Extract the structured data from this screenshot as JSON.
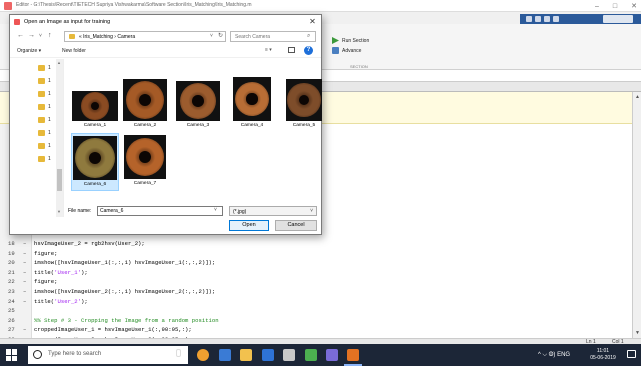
{
  "editor": {
    "title": "Editor - G:\\Thesis\\Recent\\TIETECH Supriya Vishwakarma\\Software Section\\Iris_Matching\\Iris_Matching.m",
    "ribbon": {
      "run_section": "Run Section",
      "advance": "Advance",
      "section_group": "SECTION"
    },
    "code_lines": [
      {
        "n": "18",
        "dash": "–",
        "text": "hsvImageUser_2 = rgb2hsv(User_2);",
        "kind": "code"
      },
      {
        "n": "19",
        "dash": "–",
        "text": "figure;",
        "kind": "code"
      },
      {
        "n": "20",
        "dash": "–",
        "text": "imshow([hsvImageUser_1(:,:,1) hsvImageUser_1(:,:,2)]);",
        "kind": "code"
      },
      {
        "n": "21",
        "dash": "–",
        "text_pre": "title(",
        "str": "'User_1'",
        "text_post": ");",
        "kind": "str"
      },
      {
        "n": "22",
        "dash": "–",
        "text": "figure;",
        "kind": "code"
      },
      {
        "n": "23",
        "dash": "–",
        "text": "imshow([hsvImageUser_2(:,:,1) hsvImageUser_2(:,:,2)]);",
        "kind": "code"
      },
      {
        "n": "24",
        "dash": "–",
        "text_pre": "title(",
        "str": "'User_2'",
        "text_post": ");",
        "kind": "str"
      },
      {
        "n": "25",
        "dash": "",
        "text": "",
        "kind": "code"
      },
      {
        "n": "26",
        "dash": "",
        "text": "%% Step # 3 - Cropping the Image from a random position",
        "kind": "comment"
      },
      {
        "n": "27",
        "dash": "–",
        "text": "croppedImageUser_1 = hsvImageUser_1(:,90:95,:);",
        "kind": "code"
      },
      {
        "n": "28",
        "dash": "–",
        "text": "croppedImageUser_2 = hsvImageUser_2(:,93:95,:);",
        "kind": "code"
      }
    ],
    "status": {
      "ln": "Ln  1",
      "col": "Col  1"
    }
  },
  "dialog": {
    "title": "Open an Image as input for training",
    "close_glyph": "✕",
    "nav": {
      "back": "←",
      "forward": "→",
      "recent": "˅",
      "up": "↑"
    },
    "address": "«  Iris_Matching  ›  Camera",
    "address_dropdown": "˅",
    "address_refresh": "↻",
    "search_placeholder": "Search Camera",
    "search_glyph": "⌕",
    "toolbar": {
      "organize": "Organize ▾",
      "new_folder": "New folder",
      "view": "≡ ▾",
      "help": "?"
    },
    "nav_items": [
      "1",
      "1",
      "1",
      "1",
      "1",
      "1",
      "1",
      "1"
    ],
    "nav_scroll_up": "▲",
    "nav_scroll_down": "▼",
    "files": [
      {
        "label": "Camera_1",
        "iris": "#8a4b22",
        "selected": false
      },
      {
        "label": "Camera_2",
        "iris": "#a55a26",
        "selected": false
      },
      {
        "label": "Camera_3",
        "iris": "#9c5c2e",
        "selected": false
      },
      {
        "label": "Camera_4",
        "iris": "#b86d35",
        "selected": false
      },
      {
        "label": "Camera_5",
        "iris": "#7e4d2a",
        "selected": false
      },
      {
        "label": "Camera_6",
        "iris": "#8f7a3e",
        "selected": true
      },
      {
        "label": "Camera_7",
        "iris": "#b5632a",
        "selected": false
      }
    ],
    "filename_label": "File name:",
    "filename_value": "Camera_6",
    "filename_dropdown": "˅",
    "filetype": "(*.jpg)",
    "filetype_arrow": "˅",
    "open": "Open",
    "cancel": "Cancel"
  },
  "taskbar": {
    "search_placeholder": "Type here to search",
    "clock_time": "11:01",
    "clock_date": "05-06-2019",
    "tray": "^  ⌵  ◍)  ENG"
  },
  "colors": {
    "accent": "#0078d7",
    "selection": "#cce8ff",
    "taskbar": "#1c2637",
    "folder": "#e7b93a"
  }
}
